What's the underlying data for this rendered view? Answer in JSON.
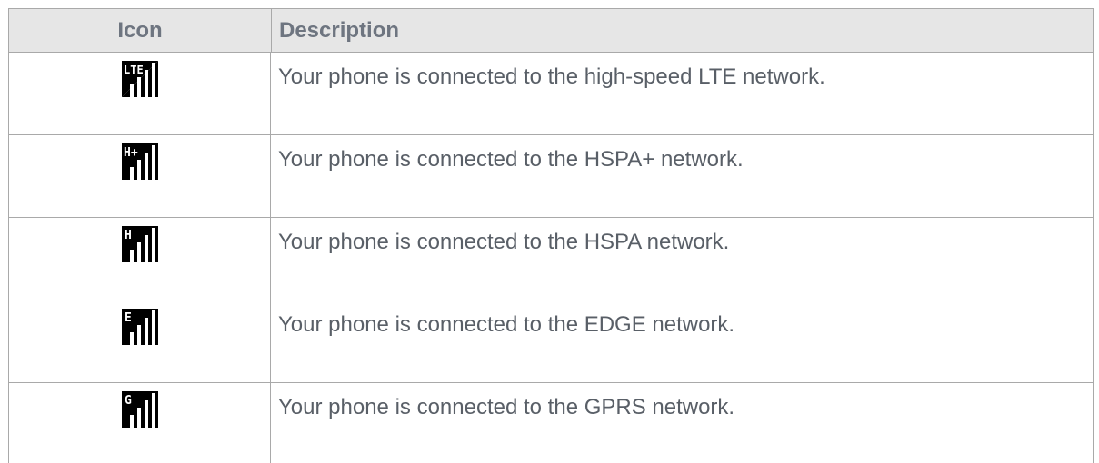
{
  "table": {
    "headers": {
      "icon": "Icon",
      "description": "Description"
    },
    "rows": [
      {
        "icon": "lte-signal-icon",
        "glyph": "LTE",
        "description": "Your phone is connected to the high-speed LTE network."
      },
      {
        "icon": "hspa-plus-signal-icon",
        "glyph": "H+",
        "description": "Your phone is connected to the HSPA+ network."
      },
      {
        "icon": "hspa-signal-icon",
        "glyph": "H",
        "description": "Your phone is connected to the HSPA network."
      },
      {
        "icon": "edge-signal-icon",
        "glyph": "E",
        "description": "Your phone is connected to the EDGE network."
      },
      {
        "icon": "gprs-signal-icon",
        "glyph": "G",
        "description": "Your phone is connected to the GPRS network."
      }
    ]
  }
}
